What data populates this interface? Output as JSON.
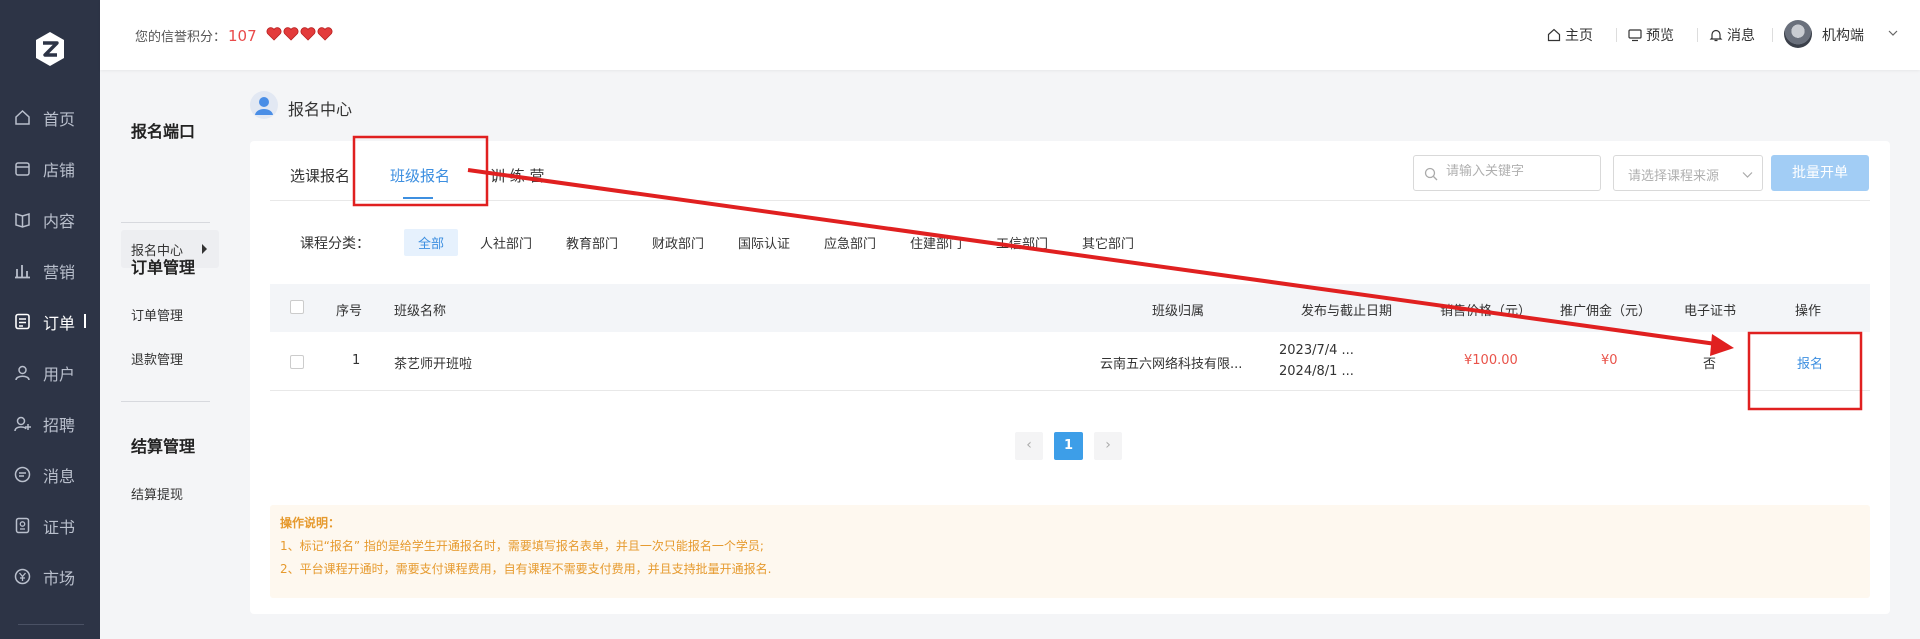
{
  "sidebar": {
    "items": [
      {
        "label": "首页",
        "icon": "home-icon"
      },
      {
        "label": "店铺",
        "icon": "shop-icon"
      },
      {
        "label": "内容",
        "icon": "book-icon"
      },
      {
        "label": "营销",
        "icon": "chart-icon"
      },
      {
        "label": "订单",
        "icon": "order-icon",
        "active": true
      },
      {
        "label": "用户",
        "icon": "user-icon"
      },
      {
        "label": "招聘",
        "icon": "recruit-icon"
      },
      {
        "label": "消息",
        "icon": "message-icon"
      },
      {
        "label": "证书",
        "icon": "certificate-icon"
      },
      {
        "label": "市场",
        "icon": "market-icon"
      }
    ]
  },
  "topbar": {
    "credit_label": "您的信誉积分：",
    "credit_value": "107",
    "hearts": 4,
    "links": {
      "home": "主页",
      "preview": "预览",
      "messages": "消息"
    },
    "user_name": "机构端"
  },
  "subnav": {
    "section1": "报名端口",
    "active_item": "报名中心",
    "section2": "订单管理",
    "order_items": [
      "订单管理",
      "退款管理"
    ],
    "section3": "结算管理",
    "settle_items": [
      "结算提现"
    ]
  },
  "breadcrumb": "报名中心",
  "tabs": [
    "选课报名",
    "班级报名",
    "训 练 营"
  ],
  "active_tab": 1,
  "search": {
    "placeholder": "请输入关键字"
  },
  "source_select": {
    "placeholder": "请选择课程来源"
  },
  "batch_button": "批量开单",
  "category": {
    "label": "课程分类：",
    "items": [
      "全部",
      "人社部门",
      "教育部门",
      "财政部门",
      "国际认证",
      "应急部门",
      "住建部门",
      "工信部门",
      "其它部门"
    ],
    "active": 0
  },
  "table": {
    "headers": [
      "序号",
      "班级名称",
      "班级归属",
      "发布与截止日期",
      "销售价格（元）",
      "推广佣金（元）",
      "电子证书",
      "操作"
    ],
    "rows": [
      {
        "index": "1",
        "name": "茶艺师开班啦",
        "owner": "云南五六网络科技有限...",
        "publish_date": "2023/7/4 ...",
        "deadline": "2024/8/1 ...",
        "price": "¥100.00",
        "commission": "¥0",
        "certificate": "否",
        "action": "报名"
      }
    ]
  },
  "pagination": {
    "current": "1",
    "prev": "‹",
    "next": "›"
  },
  "notes": {
    "title": "操作说明：",
    "lines": [
      "1、标记“报名” 指的是给学生开通报名时，需要填写报名表单，并且一次只能报名一个学员;",
      "2、平台课程开通时，需要支付课程费用，自有课程不需要支付费用，并且支持批量开通报名."
    ]
  },
  "colors": {
    "sidebar_bg": "#2d3446",
    "accent": "#3d8fe0",
    "price": "#e9534a",
    "annotation": "#e02020",
    "notes_text": "#e69a2e"
  }
}
